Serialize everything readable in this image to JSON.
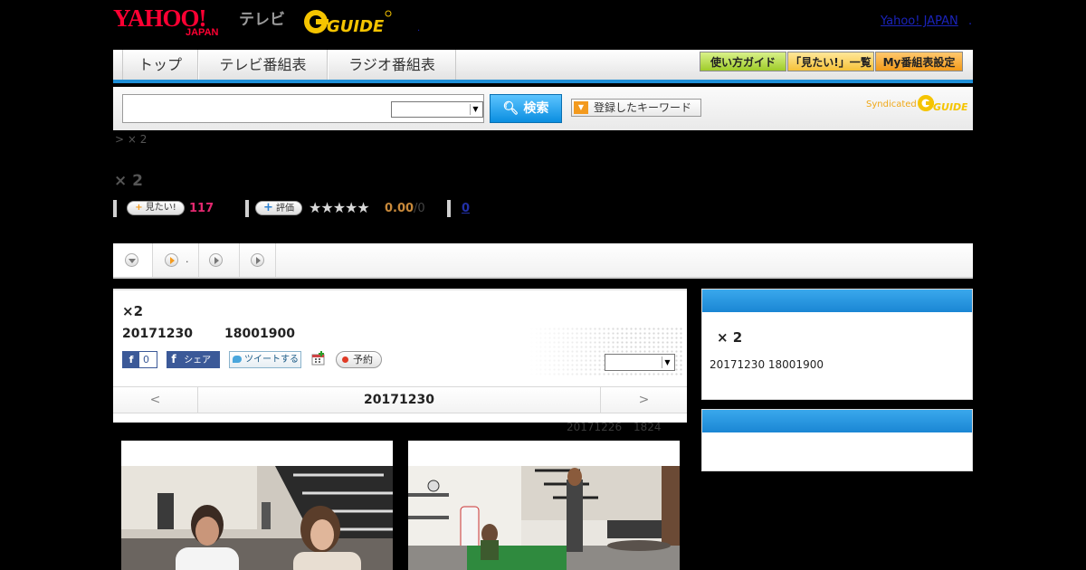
{
  "header": {
    "logo_yahoo": "YAHOO!",
    "logo_japan": "JAPAN",
    "logo_tv": "テレビ",
    "logo_gguide": "G-GUIDE",
    "yahoo_japan_link": "Yahoo! JAPAN",
    "dot_link": ".",
    "dot_link2": "."
  },
  "nav": {
    "tabs": [
      "トップ",
      "テレビ番組表",
      "ラジオ番組表"
    ],
    "buttons": [
      "使い方ガイド",
      "「見たい!」一覧",
      "My番組表設定"
    ]
  },
  "search": {
    "input_value": "",
    "select_value": "",
    "search_button": "検索",
    "keyword_button": "登録したキーワード",
    "syndicated": "Syndicated"
  },
  "breadcrumb": "> × 2",
  "page_title": "× 2",
  "stats": {
    "want_label": "見たい!",
    "want_count": "117",
    "rate_label": "評価",
    "stars": "★★★★★",
    "score": "0.00",
    "score_den": "/0",
    "zero_link": "0"
  },
  "subtabs": {
    "dot_label": "."
  },
  "program": {
    "title": "×2",
    "date": "20171230",
    "time": "18001900",
    "fb_count": "0",
    "share_label": "シェア",
    "tweet_label": "ツイートする",
    "reserve_label": "予約",
    "select_value": "",
    "prev": "<",
    "nav_date": "20171230",
    "next": ">",
    "updated_date": "20171226",
    "updated_time": "1824"
  },
  "sidebar": {
    "box1_title": "× 2",
    "box1_meta": "20171230  18001900"
  },
  "colors": {
    "accent_blue": "#1e8fd8",
    "yahoo_red": "#ff0033",
    "want_pink": "#e3286f",
    "gguide_yellow": "#f5c400"
  }
}
